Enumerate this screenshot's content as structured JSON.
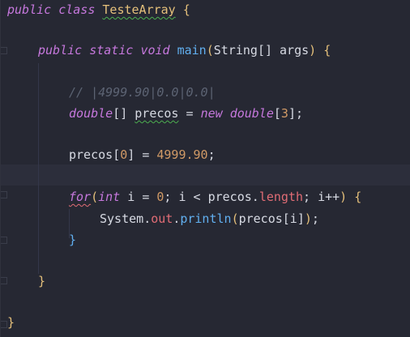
{
  "code": {
    "l1_kw1": "public",
    "l1_kw2": "class",
    "l1_name": "TesteArray",
    "l1_brace": "{",
    "l2_kw1": "public",
    "l2_kw2": "static",
    "l2_kw3": "void",
    "l2_fn": "main",
    "l2_paren_open": "(",
    "l2_type": "String",
    "l2_brackets": "[]",
    "l2_arg": "args",
    "l2_paren_close": ")",
    "l2_brace": "{",
    "l3_comment": "// |4999.90|0.0|0.0|",
    "l4_type": "double",
    "l4_brackets": "[]",
    "l4_var": "precos",
    "l4_eq": "=",
    "l4_new": "new",
    "l4_type2": "double",
    "l4_idx_open": "[",
    "l4_num": "3",
    "l4_idx_close": "];",
    "l5_var": "precos",
    "l5_idx_open": "[",
    "l5_num": "0",
    "l5_idx_close": "]",
    "l5_eq": "=",
    "l5_val": "4999.90",
    "l5_semi": ";",
    "l6_for": "for",
    "l6_paren_open": "(",
    "l6_int": "int",
    "l6_i_decl": "i",
    "l6_eq": "=",
    "l6_zero": "0",
    "l6_semi1": ";",
    "l6_i_cmp": "i",
    "l6_lt": "<",
    "l6_precos": "precos",
    "l6_dot": ".",
    "l6_length": "length",
    "l6_semi2": ";",
    "l6_inc": "i++",
    "l6_paren_close": ")",
    "l6_brace": "{",
    "l7_system": "System",
    "l7_dot1": ".",
    "l7_out": "out",
    "l7_dot2": ".",
    "l7_println": "println",
    "l7_paren_open": "(",
    "l7_arg": "precos",
    "l7_idx": "[i]",
    "l7_paren_close": ")",
    "l7_semi": ";",
    "l8_brace": "}",
    "l9_brace": "}",
    "l10_brace": "}"
  },
  "colors": {
    "background": "#262833",
    "keyword": "#c678dd",
    "type": "#e5c07b",
    "function": "#61afef",
    "number": "#d19a66",
    "field": "#e06c75",
    "comment": "#5c6373"
  }
}
